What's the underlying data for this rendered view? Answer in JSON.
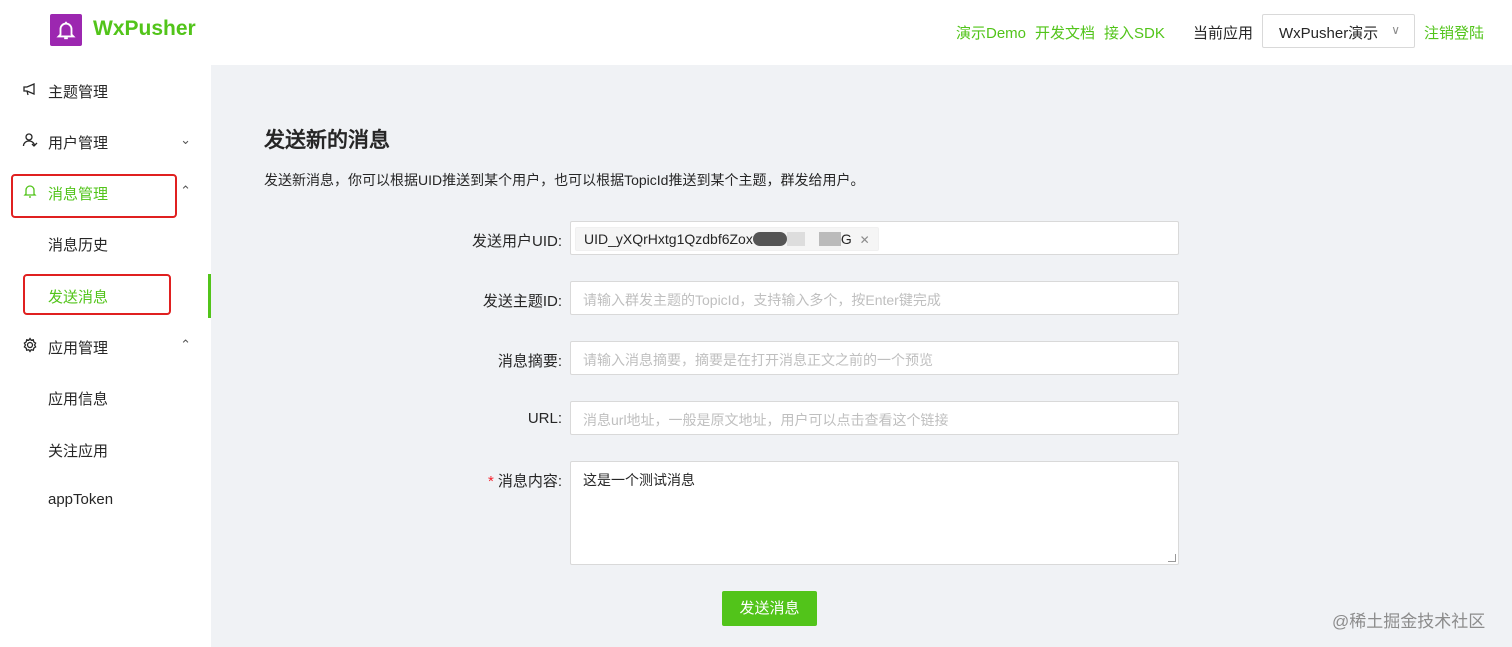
{
  "header": {
    "logo_text": "WxPusher",
    "links": [
      "演示Demo",
      "开发文档",
      "接入SDK"
    ],
    "current_app_label": "当前应用",
    "current_app_value": "WxPusher演示",
    "logout": "注销登陆"
  },
  "sidebar": {
    "items": [
      {
        "label": "主题管理"
      },
      {
        "label": "用户管理"
      },
      {
        "label": "消息管理"
      },
      {
        "label": "消息历史"
      },
      {
        "label": "发送消息"
      },
      {
        "label": "应用管理"
      },
      {
        "label": "应用信息"
      },
      {
        "label": "关注应用"
      },
      {
        "label": "appToken"
      }
    ]
  },
  "main": {
    "title": "发送新的消息",
    "description": "发送新消息，你可以根据UID推送到某个用户，也可以根据TopicId推送到某个主题，群发给用户。",
    "form": {
      "uid_label": "发送用户UID",
      "uid_tag": "UID_yXQrHxtg1Qzdbf6Zox",
      "uid_tag_end": "G",
      "topic_label": "发送主题ID",
      "topic_placeholder": "请输入群发主题的TopicId，支持输入多个，按Enter键完成",
      "summary_label": "消息摘要",
      "summary_placeholder": "请输入消息摘要，摘要是在打开消息正文之前的一个预览",
      "url_label": "URL",
      "url_placeholder": "消息url地址，一般是原文地址，用户可以点击查看这个链接",
      "content_label": "消息内容",
      "content_value": "这是一个测试消息",
      "submit": "发送消息"
    }
  },
  "watermark": "@稀土掘金技术社区",
  "colors": {
    "accent": "#52c41a",
    "logo_bg": "#9c27b0",
    "highlight_box": "#e02020"
  }
}
